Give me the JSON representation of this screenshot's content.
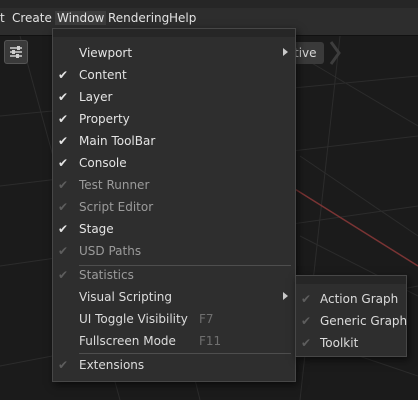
{
  "menubar": {
    "items": [
      "t",
      "Create",
      "Window",
      "Rendering",
      "Help"
    ]
  },
  "viewport": {
    "tag_label": "tive"
  },
  "window_menu": {
    "items": [
      {
        "label": "Viewport",
        "checked": false,
        "submenu": true
      },
      {
        "label": "Content",
        "checked": true
      },
      {
        "label": "Layer",
        "checked": true
      },
      {
        "label": "Property",
        "checked": true
      },
      {
        "label": "Main ToolBar",
        "checked": true
      },
      {
        "label": "Console",
        "checked": true
      },
      {
        "label": "Test Runner",
        "checked": false
      },
      {
        "label": "Script Editor",
        "checked": false
      },
      {
        "label": "Stage",
        "checked": true
      },
      {
        "label": "USD Paths",
        "checked": false
      },
      {
        "label": "Statistics",
        "checked": false
      },
      {
        "label": "Visual Scripting",
        "checked": false,
        "submenu": true
      },
      {
        "label": "UI Toggle Visibility",
        "checked": false,
        "shortcut": "F7"
      },
      {
        "label": "Fullscreen Mode",
        "checked": false,
        "shortcut": "F11"
      },
      {
        "label": "Extensions",
        "checked": false
      }
    ]
  },
  "visual_scripting_submenu": {
    "items": [
      {
        "label": "Action Graph",
        "checked": false
      },
      {
        "label": "Generic Graph",
        "checked": false
      },
      {
        "label": "Toolkit",
        "checked": false
      }
    ]
  },
  "icons": {
    "check": "✔",
    "settings": "sliders-icon"
  },
  "colors": {
    "menu_bg": "#2e2e2e",
    "menubar_bg": "#2d2d2d",
    "viewport_bg": "#1b1b1b",
    "axis_red": "#7a3434"
  }
}
